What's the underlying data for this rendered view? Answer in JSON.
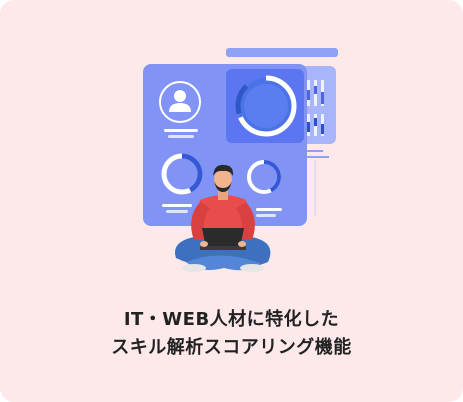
{
  "caption": {
    "line1": "IT・WEB人材に特化した",
    "line2": "スキル解析スコアリング機能"
  },
  "colors": {
    "card_background": "#fde9ea",
    "panel_primary": "#7f90f4",
    "panel_secondary": "#a9b5fb",
    "panel_accent": "#5873f0",
    "ring_fill": "#4a73e8",
    "sweater": "#e84c4c",
    "jeans": "#3f6fbf",
    "laptop": "#2b2b2b",
    "skin": "#f2b38f",
    "hair": "#2a2a2a"
  },
  "icons": {
    "user": "user-avatar-icon",
    "donut_large": "donut-chart-icon",
    "donut_small_left": "donut-chart-icon",
    "donut_small_right": "donut-chart-icon",
    "bars": "vertical-bar-chart-icon"
  }
}
